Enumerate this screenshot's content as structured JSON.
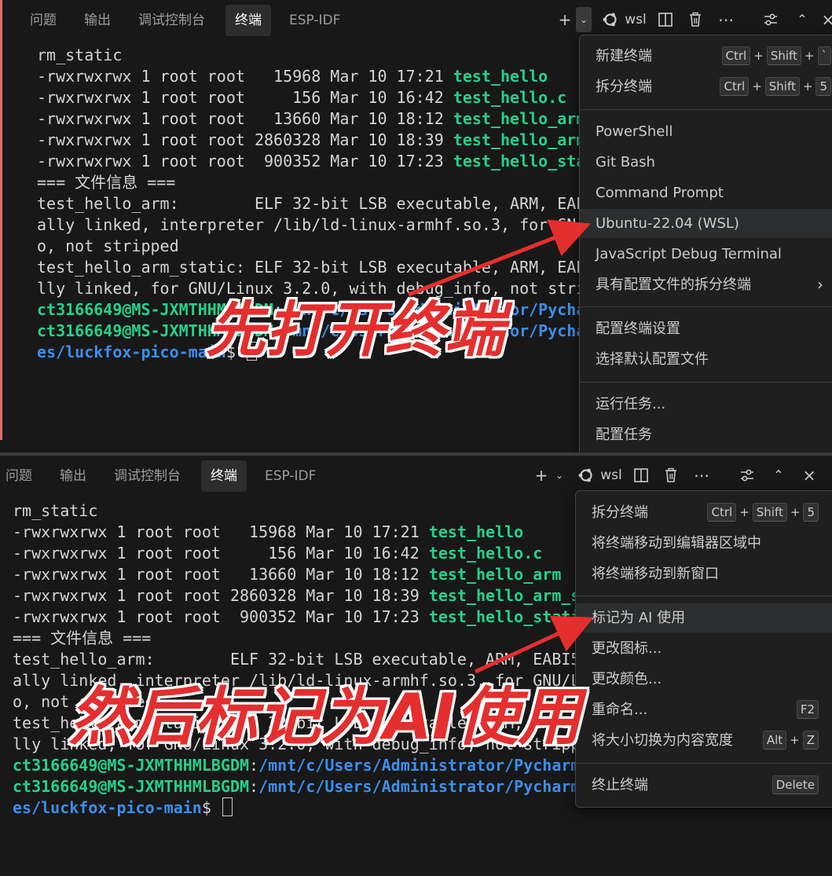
{
  "panel_a": {
    "tabs": [
      "问题",
      "输出",
      "调试控制台",
      "终端",
      "ESP-IDF"
    ],
    "active_tab": "终端",
    "toolbar": {
      "profile_label": "wsl"
    },
    "terminal_lines": [
      [
        {
          "t": "rm_static",
          "c": "n"
        }
      ],
      [
        {
          "t": "-rwxrwxrwx 1 root root   15968 Mar 10 17:21 ",
          "c": "n"
        },
        {
          "t": "test_hello",
          "c": "g"
        }
      ],
      [
        {
          "t": "-rwxrwxrwx 1 root root     156 Mar 10 16:42 ",
          "c": "n"
        },
        {
          "t": "test_hello.c",
          "c": "g"
        }
      ],
      [
        {
          "t": "-rwxrwxrwx 1 root root   13660 Mar 10 18:12 ",
          "c": "n"
        },
        {
          "t": "test_hello_arm",
          "c": "g"
        }
      ],
      [
        {
          "t": "-rwxrwxrwx 1 root root 2860328 Mar 10 18:39 ",
          "c": "n"
        },
        {
          "t": "test_hello_arm",
          "c": "g"
        }
      ],
      [
        {
          "t": "-rwxrwxrwx 1 root root  900352 Mar 10 17:23 ",
          "c": "n"
        },
        {
          "t": "test_hello_sta",
          "c": "g"
        }
      ],
      [
        {
          "t": "=== 文件信息 ===",
          "c": "n"
        }
      ],
      [
        {
          "t": "test_hello_arm:        ELF 32-bit LSB executable, ARM, EAB",
          "c": "n"
        }
      ],
      [
        {
          "t": "ally linked, interpreter /lib/ld-linux-armhf.so.3, for GN",
          "c": "n"
        }
      ],
      [
        {
          "t": "o, not stripped",
          "c": "n"
        }
      ],
      [
        {
          "t": "test_hello_arm_static: ELF 32-bit LSB executable, ARM, EAB",
          "c": "n"
        }
      ],
      [
        {
          "t": "lly linked, for GNU/Linux 3.2.0, with debug_info, not stri",
          "c": "n"
        }
      ],
      [
        {
          "t": "ct3166649@MS-JXMTHHMLBGDM",
          "c": "g"
        },
        {
          "t": ":",
          "c": "n"
        },
        {
          "t": "/mnt/c/Users/Administrator/Pycha",
          "c": "b"
        }
      ],
      [
        {
          "t": "ct3166649@MS-JXMTHHMLBGDM",
          "c": "g"
        },
        {
          "t": ":",
          "c": "n"
        },
        {
          "t": "/mnt/c/Users/Administrator/Pycha",
          "c": "b"
        }
      ],
      [
        {
          "t": "es/luckfox-pico-main",
          "c": "b"
        },
        {
          "t": "$ ",
          "c": "n"
        },
        {
          "t": "",
          "c": "cursor"
        }
      ]
    ],
    "menu": {
      "items": [
        {
          "label": "新建终端",
          "keys": [
            "Ctrl",
            "Shift",
            "`"
          ]
        },
        {
          "label": "拆分终端",
          "keys": [
            "Ctrl",
            "Shift",
            "5"
          ]
        },
        {
          "label": "PowerShell"
        },
        {
          "label": "Git Bash"
        },
        {
          "label": "Command Prompt"
        },
        {
          "label": "Ubuntu-22.04 (WSL)"
        },
        {
          "label": "JavaScript Debug Terminal"
        },
        {
          "label": "具有配置文件的拆分终端",
          "submenu": true
        },
        {
          "label": "配置终端设置"
        },
        {
          "label": "选择默认配置文件"
        },
        {
          "label": "运行任务..."
        },
        {
          "label": "配置任务"
        }
      ]
    },
    "annotation": "先打开终端"
  },
  "panel_b": {
    "tabs": [
      "问题",
      "输出",
      "调试控制台",
      "终端",
      "ESP-IDF"
    ],
    "active_tab": "终端",
    "toolbar": {
      "profile_label": "wsl"
    },
    "terminal_lines": [
      [
        {
          "t": "rm_static",
          "c": "n"
        }
      ],
      [
        {
          "t": "-rwxrwxrwx 1 root root   15968 Mar 10 17:21 ",
          "c": "n"
        },
        {
          "t": "test_hello",
          "c": "g"
        }
      ],
      [
        {
          "t": "-rwxrwxrwx 1 root root     156 Mar 10 16:42 ",
          "c": "n"
        },
        {
          "t": "test_hello.c",
          "c": "g"
        }
      ],
      [
        {
          "t": "-rwxrwxrwx 1 root root   13660 Mar 10 18:12 ",
          "c": "n"
        },
        {
          "t": "test_hello_arm",
          "c": "g"
        }
      ],
      [
        {
          "t": "-rwxrwxrwx 1 root root 2860328 Mar 10 18:39 ",
          "c": "n"
        },
        {
          "t": "test_hello_arm_s",
          "c": "g"
        }
      ],
      [
        {
          "t": "-rwxrwxrwx 1 root root  900352 Mar 10 17:23 ",
          "c": "n"
        },
        {
          "t": "test_hello_stati",
          "c": "g"
        }
      ],
      [
        {
          "t": "=== 文件信息 ===",
          "c": "n"
        }
      ],
      [
        {
          "t": "test_hello_arm:        ELF 32-bit LSB executable, ARM, EABI5",
          "c": "n"
        }
      ],
      [
        {
          "t": "ally linked, interpreter /lib/ld-linux-armhf.so.3, for GNU/L",
          "c": "n"
        }
      ],
      [
        {
          "t": "o, not stripped",
          "c": "n"
        }
      ],
      [
        {
          "t": "test_hello_arm_static: ELF 32-bit LSB executable, ARM, EABI5",
          "c": "n"
        }
      ],
      [
        {
          "t": "lly linked, for GNU/Linux 3.2.0, with debug_info, not stripp",
          "c": "n"
        }
      ],
      [
        {
          "t": "ct3166649@MS-JXMTHHMLBGDM",
          "c": "g"
        },
        {
          "t": ":",
          "c": "n"
        },
        {
          "t": "/mnt/c/Users/Administrator/Pycharm",
          "c": "b"
        }
      ],
      [
        {
          "t": "ct3166649@MS-JXMTHHMLBGDM",
          "c": "g"
        },
        {
          "t": ":",
          "c": "n"
        },
        {
          "t": "/mnt/c/Users/Administrator/Pycharm",
          "c": "b"
        }
      ],
      [
        {
          "t": "es/luckfox-pico-main",
          "c": "b"
        },
        {
          "t": "$ ",
          "c": "n"
        },
        {
          "t": "",
          "c": "cursor"
        }
      ]
    ],
    "menu": {
      "items": [
        {
          "label": "拆分终端",
          "keys": [
            "Ctrl",
            "Shift",
            "5"
          ]
        },
        {
          "label": "将终端移动到编辑器区域中"
        },
        {
          "label": "将终端移动到新窗口"
        },
        {
          "label": "标记为 AI 使用"
        },
        {
          "label": "更改图标..."
        },
        {
          "label": "更改颜色..."
        },
        {
          "label": "重命名...",
          "keys": [
            "F2"
          ]
        },
        {
          "label": "将大小切换为内容宽度",
          "keys": [
            "Alt",
            "Z"
          ]
        },
        {
          "label": "终止终端",
          "keys": [
            "Delete"
          ]
        }
      ]
    },
    "annotation": "然后标记为AI使用"
  },
  "colors": {
    "terminal_bg": "#181818",
    "green": "#23d18b",
    "blue": "#3b8eea",
    "annotation_red": "#e52e2e"
  }
}
